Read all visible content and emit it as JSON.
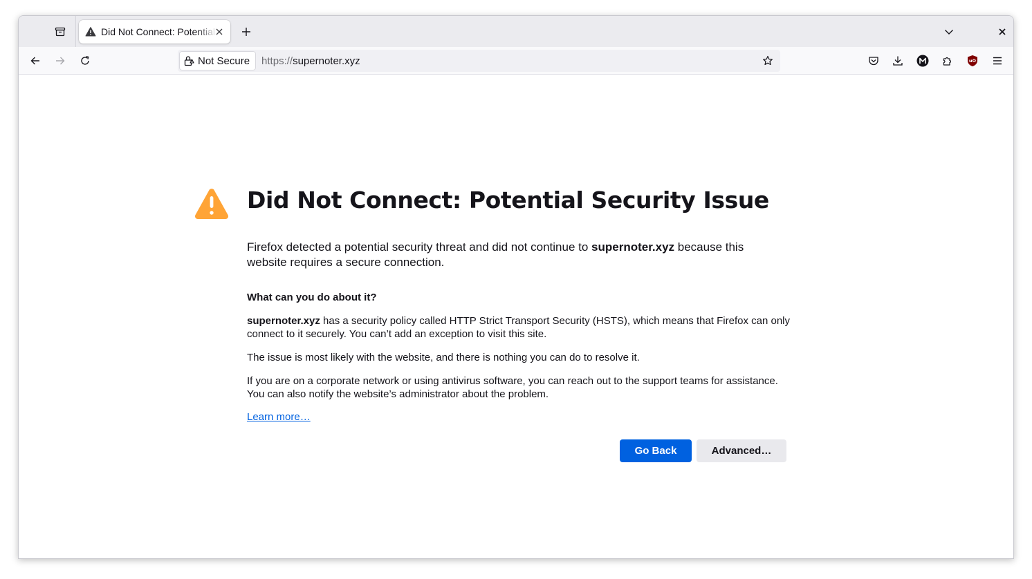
{
  "tab": {
    "title": "Did Not Connect: Potential Security Issue",
    "icon": "warning-icon"
  },
  "toolbar": {
    "identity_label": "Not Secure",
    "url_scheme": "https://",
    "url_host": "supernoter.xyz"
  },
  "page": {
    "title": "Did Not Connect: Potential Security Issue",
    "intro_before": "Firefox detected a potential security threat and did not continue to ",
    "intro_host": "supernoter.xyz",
    "intro_after": " because this website requires a secure connection.",
    "what_heading": "What can you do about it?",
    "p1_host": "supernoter.xyz",
    "p1_text": " has a security policy called HTTP Strict Transport Security (HSTS), which means that Firefox can only connect to it securely. You can’t add an exception to visit this site.",
    "p2_text": "The issue is most likely with the website, and there is nothing you can do to resolve it.",
    "p3_text": "If you are on a corporate network or using antivirus software, you can reach out to the support teams for assistance. You can also notify the website’s administrator about the problem.",
    "learn_more": "Learn more…",
    "go_back": "Go Back",
    "advanced": "Advanced…"
  },
  "colors": {
    "accent": "#0061e0",
    "warning": "#ffa436",
    "tabstrip_bg": "#ebebef",
    "toolbar_bg": "#f9f9fb",
    "ublock_red": "#800000"
  }
}
